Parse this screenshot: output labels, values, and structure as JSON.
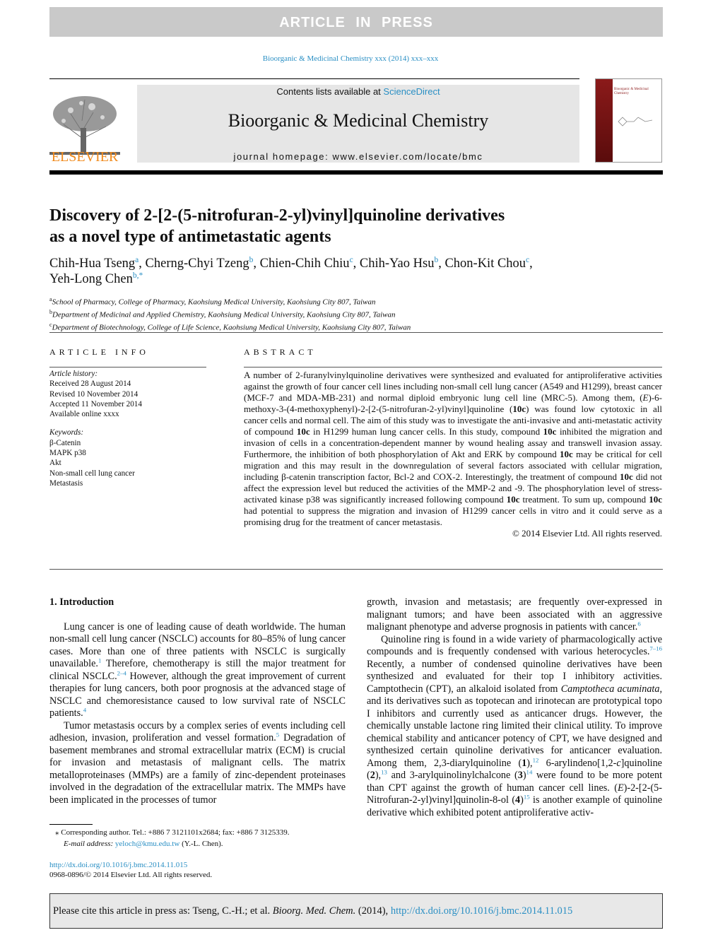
{
  "banner": "ARTICLE IN PRESS",
  "journal_citation": "Bioorganic & Medicinal Chemistry xxx (2014) xxx–xxx",
  "header": {
    "publisher": "ELSEVIER",
    "contents_prefix": "Contents lists available at ",
    "sciencedirect": "ScienceDirect",
    "journal_name": "Bioorganic & Medicinal Chemistry",
    "homepage": "journal homepage: www.elsevier.com/locate/bmc",
    "cover_title": "Bioorganic & Medicinal Chemistry"
  },
  "title_line1": "Discovery of 2-[2-(5-nitrofuran-2-yl)vinyl]quinoline derivatives",
  "title_line2": "as a novel type of antimetastatic agents",
  "authors": [
    {
      "name": "Chih-Hua Tseng",
      "aff": "a",
      "sep": ", "
    },
    {
      "name": "Cherng-Chyi Tzeng",
      "aff": "b",
      "sep": ", "
    },
    {
      "name": "Chien-Chih Chiu",
      "aff": "c",
      "sep": ", "
    },
    {
      "name": "Chih-Yao Hsu",
      "aff": "b",
      "sep": ", "
    },
    {
      "name": "Chon-Kit Chou",
      "aff": "c",
      "sep": ","
    },
    {
      "name": "Yeh-Long Chen",
      "aff": "b,*",
      "sep": ""
    }
  ],
  "affiliations": [
    {
      "letter": "a",
      "text": "School of Pharmacy, College of Pharmacy, Kaohsiung Medical University, Kaohsiung City 807, Taiwan"
    },
    {
      "letter": "b",
      "text": "Department of Medicinal and Applied Chemistry, Kaohsiung Medical University, Kaohsiung City 807, Taiwan"
    },
    {
      "letter": "c",
      "text": "Department of Biotechnology, College of Life Science, Kaohsiung Medical University, Kaohsiung City 807, Taiwan"
    }
  ],
  "article_info": {
    "heading": "ARTICLE INFO",
    "history_label": "Article history:",
    "history": [
      "Received 28 August 2014",
      "Revised 10 November 2014",
      "Accepted 11 November 2014",
      "Available online xxxx"
    ],
    "keywords_label": "Keywords:",
    "keywords": [
      "β-Catenin",
      "MAPK p38",
      "Akt",
      "Non-small cell lung cancer",
      "Metastasis"
    ]
  },
  "abstract": {
    "heading": "ABSTRACT",
    "segments": [
      {
        "t": "A number of 2-furanylvinylquinoline derivatives were synthesized and evaluated for antiproliferative activities against the growth of four cancer cell lines including non-small cell lung cancer (A549 and H1299), breast cancer (MCF-7 and MDA-MB-231) and normal diploid embryonic lung cell line (MRC-5). Among them, ("
      },
      {
        "t": "E",
        "s": "i"
      },
      {
        "t": ")-6-methoxy-3-(4-methoxyphenyl)-2-[2-(5-nitrofuran-2-yl)vinyl]quinoline ("
      },
      {
        "t": "10c",
        "s": "b"
      },
      {
        "t": ") was found low cytotoxic in all cancer cells and normal cell. The aim of this study was to investigate the anti-invasive and anti-metastatic activity of compound "
      },
      {
        "t": "10c",
        "s": "b"
      },
      {
        "t": " in H1299 human lung cancer cells. In this study, compound "
      },
      {
        "t": "10c",
        "s": "b"
      },
      {
        "t": " inhibited the migration and invasion of cells in a concentration-dependent manner by wound healing assay and transwell invasion assay. Furthermore, the inhibition of both phosphoryla­tion of Akt and ERK by compound "
      },
      {
        "t": "10c",
        "s": "b"
      },
      {
        "t": " may be critical for cell migration and this may result in the down­regulation of several factors associated with cellular migration, including β-catenin transcription factor, Bcl-2 and COX-2. Interestingly, the treatment of compound "
      },
      {
        "t": "10c",
        "s": "b"
      },
      {
        "t": " did not affect the expression level but reduced the activities of the MMP-2 and -9. The phosphorylation level of stress-activated kinase p38 was significantly increased following compound "
      },
      {
        "t": "10c",
        "s": "b"
      },
      {
        "t": " treatment. To sum up, compound "
      },
      {
        "t": "10c",
        "s": "b"
      },
      {
        "t": " had potential to suppress the migration and invasion of H1299 cancer cells in vitro and it could serve as a promising drug for the treatment of cancer metastasis."
      }
    ],
    "copyright": "© 2014 Elsevier Ltd. All rights reserved."
  },
  "intro": {
    "heading": "1. Introduction",
    "left_paragraphs": [
      [
        {
          "t": "Lung cancer is one of leading cause of death worldwide. The human non-small cell lung cancer (NSCLC) accounts for 80–85% of lung cancer cases. More than one of three patients with NSCLC is surgically unavailable."
        },
        {
          "t": "1",
          "s": "sup"
        },
        {
          "t": " Therefore, chemotherapy is still the major treatment for clinical NSCLC."
        },
        {
          "t": "2–4",
          "s": "sup"
        },
        {
          "t": " However, although the great improvement of current therapies for lung cancers, both poor prog­nosis at the advanced stage of NSCLC and chemoresistance caused to low survival rate of NSCLC patients."
        },
        {
          "t": "4",
          "s": "sup"
        }
      ],
      [
        {
          "t": "Tumor metastasis occurs by a complex series of events including cell adhesion, invasion, proliferation and vessel formation."
        },
        {
          "t": "5",
          "s": "sup"
        },
        {
          "t": " Degra­dation of basement membranes and stromal extracellular matrix (ECM) is crucial for invasion and metastasis of malignant cells. The matrix metalloproteinases (MMPs) are a family of zinc-depen­dent proteinases involved in the degradation of the extracellular matrix. The MMPs have been implicated in the processes of tumor"
        }
      ]
    ],
    "right_paragraphs": [
      [
        {
          "t": "growth, invasion and metastasis; are frequently over-expressed in malignant tumors; and have been associated with an aggressive malignant phenotype and adverse prognosis in patients with cancer."
        },
        {
          "t": "6",
          "s": "sup"
        }
      ],
      [
        {
          "t": "Quinoline ring is found in a wide variety of pharmacologically active compounds and is frequently condensed with various het­erocycles."
        },
        {
          "t": "7–16",
          "s": "sup"
        },
        {
          "t": " Recently, a number of condensed quinoline deriva­tives have been synthesized and evaluated for their top I inhibitory activities. Camptothecin (CPT), an alkaloid isolated from "
        },
        {
          "t": "Camptotheca acuminata",
          "s": "i"
        },
        {
          "t": ", and its derivatives such as topotecan and irinotecan are prototypical topo I inhibitors and currently used as anticancer drugs. However, the chemically unstable lactone ring limited their clinical utility. To improve chemical stability and anti­cancer potency of CPT, we have designed and synthesized certain quinoline derivatives for anticancer evaluation. Among them, 2,3-diarylquinoline ("
        },
        {
          "t": "1",
          "s": "b"
        },
        {
          "t": "),"
        },
        {
          "t": "12",
          "s": "sup"
        },
        {
          "t": " 6-arylindeno[1,2-"
        },
        {
          "t": "c",
          "s": "i"
        },
        {
          "t": "]quinoline ("
        },
        {
          "t": "2",
          "s": "b"
        },
        {
          "t": "),"
        },
        {
          "t": "13",
          "s": "sup"
        },
        {
          "t": " and 3-arylquinolinylchalcone ("
        },
        {
          "t": "3",
          "s": "b"
        },
        {
          "t": ")"
        },
        {
          "t": "14",
          "s": "sup"
        },
        {
          "t": " were found to be more potent than CPT against the growth of human cancer cell lines. ("
        },
        {
          "t": "E",
          "s": "i"
        },
        {
          "t": ")-2-[2-(5-Nitrofuran-2-yl)vinyl]quinolin-8-ol ("
        },
        {
          "t": "4",
          "s": "b"
        },
        {
          "t": ")"
        },
        {
          "t": "15",
          "s": "sup"
        },
        {
          "t": " is another example of quinoline derivative which exhibited potent antiproliferative activ-"
        }
      ]
    ]
  },
  "footnote": {
    "marker": "⁎",
    "corresponding": "Corresponding author. Tel.: +886 7 3121101x2684; fax: +886 7 3125339.",
    "email_label": "E-mail address:",
    "email": "yeloch@kmu.edu.tw",
    "email_suffix": " (Y.-L. Chen).",
    "doi": "http://dx.doi.org/10.1016/j.bmc.2014.11.015",
    "issn": "0968-0896/© 2014 Elsevier Ltd. All rights reserved."
  },
  "cite_box": {
    "prefix": "Please cite this article in press as: Tseng, C.-H.; et al. ",
    "journal": "Bioorg. Med. Chem.",
    "year": " (2014), ",
    "doi": "http://dx.doi.org/10.1016/j.bmc.2014.11.015"
  },
  "colors": {
    "link": "#2a8fc4",
    "banner": "#c9c9c9",
    "elsevier_orange": "#f08a1c",
    "cover_red": "#8b1a1a"
  }
}
